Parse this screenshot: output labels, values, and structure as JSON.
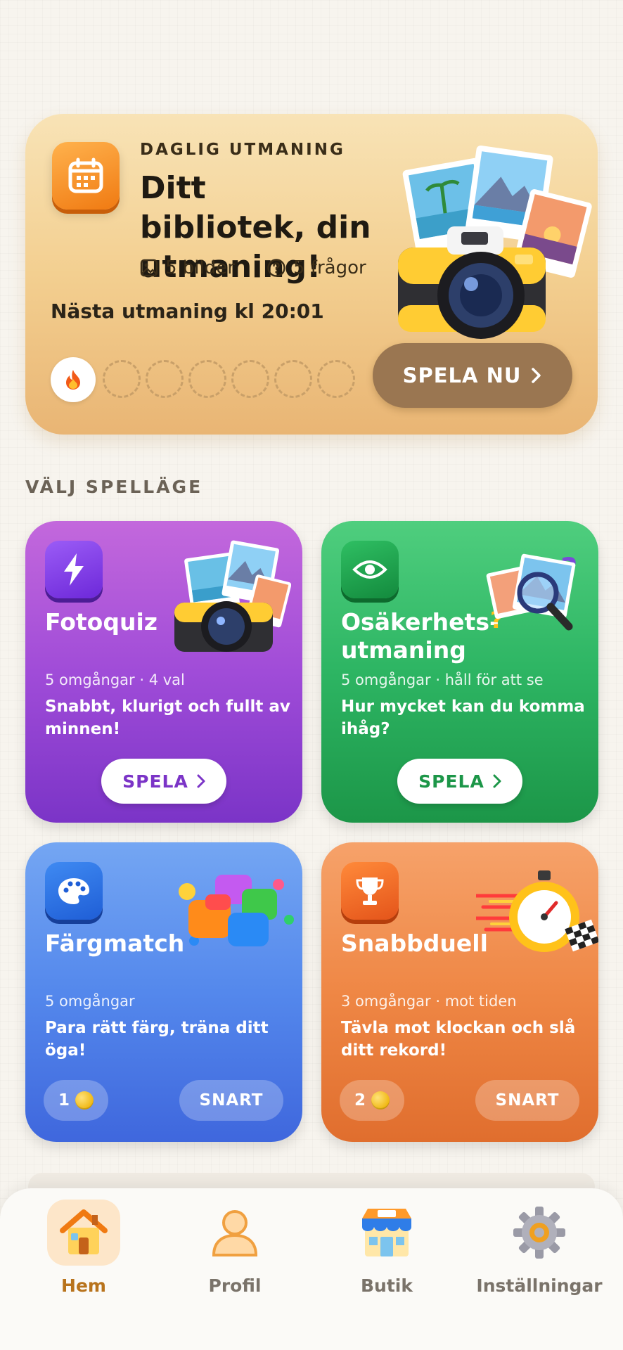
{
  "daily": {
    "kicker": "DAGLIG UTMANING",
    "title": "Ditt bibliotek, din utmaning!",
    "images_meta": "5 bilder",
    "questions_meta": "5 frågor",
    "next_challenge": "Nästa utmaning kl 20:01",
    "play_button": "SPELA NU",
    "streak_slots_empty": 6
  },
  "section_title": "VÄLJ SPELLÄGE",
  "modes": [
    {
      "title": "Fotoquiz",
      "subtitle": "5 omgångar · 4 val",
      "description": "Snabbt, klurigt och fullt av minnen!",
      "button": "SPELA",
      "color": "#8e43d4"
    },
    {
      "title": "Osäkerhets-utmaning",
      "title_line1": "Osäkerhets-",
      "title_line2": "utmaning",
      "subtitle": "5 omgångar · håll för att se",
      "description": "Hur mycket kan du komma ihåg?",
      "button": "SPELA",
      "color": "#26a957"
    },
    {
      "title": "Färgmatch",
      "subtitle": "5 omgångar",
      "description": "Para rätt färg, träna ditt öga!",
      "coins": "1",
      "button": "SNART",
      "color": "#4a7ae6"
    },
    {
      "title": "Snabbduell",
      "subtitle": "3 omgångar · mot tiden",
      "description": "Tävla mot klockan och slå ditt rekord!",
      "coins": "2",
      "button": "SNART",
      "color": "#ea7a3a"
    }
  ],
  "nav": [
    {
      "label": "Hem",
      "icon": "home-icon",
      "active": true
    },
    {
      "label": "Profil",
      "icon": "profile-icon",
      "active": false
    },
    {
      "label": "Butik",
      "icon": "shop-icon",
      "active": false
    },
    {
      "label": "Inställningar",
      "icon": "settings-icon",
      "active": false
    }
  ]
}
